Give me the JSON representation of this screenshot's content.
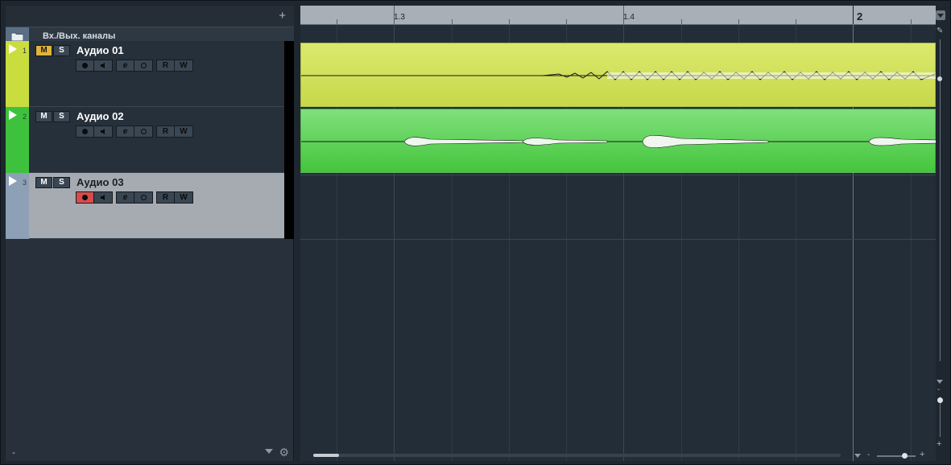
{
  "toolbar": {
    "add_track_label": "+"
  },
  "folder_row": {
    "label": "Вх./Вых. каналы",
    "icon": "folder-icon"
  },
  "tracks": [
    {
      "number": "1",
      "name": "Аудио 01",
      "color": "#c9dd3f",
      "mute_label": "M",
      "solo_label": "S",
      "mute_active": true,
      "record_armed": false,
      "read_label": "R",
      "write_label": "W",
      "edit_label": "e"
    },
    {
      "number": "2",
      "name": "Аудио 02",
      "color": "#3ec23e",
      "mute_label": "M",
      "solo_label": "S",
      "mute_active": false,
      "record_armed": false,
      "read_label": "R",
      "write_label": "W",
      "edit_label": "e"
    },
    {
      "number": "3",
      "name": "Аудио 03",
      "color": "#8ea0b6",
      "mute_label": "M",
      "solo_label": "S",
      "mute_active": false,
      "record_armed": true,
      "read_label": "R",
      "write_label": "W",
      "edit_label": "e",
      "selected": true
    }
  ],
  "ruler": {
    "labels": [
      "1.3",
      "1.4",
      "2"
    ]
  },
  "events": [
    {
      "track": "Аудио 01",
      "color": "#d0e15a"
    },
    {
      "track": "Аудио 02",
      "color": "#5dd257"
    }
  ],
  "footer": {
    "minus_label": "-",
    "zoom_minus": "-",
    "zoom_plus": "+",
    "vzoom_minus": "-",
    "vzoom_plus": "+"
  },
  "colors": {
    "mute_active": "#e0b43a",
    "record_armed": "#d84b4b",
    "background": "#1e262f"
  }
}
